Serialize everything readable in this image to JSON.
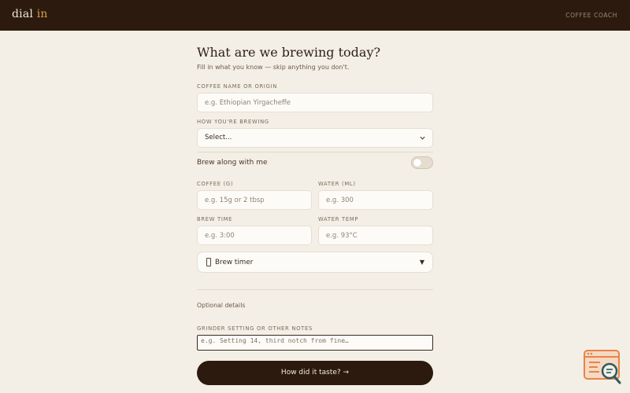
{
  "header": {
    "brand_main": "dial ",
    "brand_accent": "in",
    "nav_link": "COFFEE COACH"
  },
  "form": {
    "title": "What are we brewing today?",
    "subtitle": "Fill in what you know — skip anything you don't.",
    "coffee_name": {
      "label": "COFFEE NAME OR ORIGIN",
      "placeholder": "e.g. Ethiopian Yirgacheffe",
      "value": ""
    },
    "brew_method": {
      "label": "HOW YOU'RE BREWING",
      "selected": "Select..."
    },
    "brew_along": {
      "label": "Brew along with me",
      "enabled": false
    },
    "coffee_amount": {
      "label": "COFFEE (G)",
      "placeholder": "e.g. 15g or 2 tbsp",
      "value": ""
    },
    "water_amount": {
      "label": "WATER (ML)",
      "placeholder": "e.g. 300",
      "value": ""
    },
    "brew_time": {
      "label": "BREW TIME",
      "placeholder": "e.g. 3:00",
      "value": ""
    },
    "water_temp": {
      "label": "WATER TEMP",
      "placeholder": "e.g. 93°C",
      "value": ""
    },
    "timer": {
      "icon": "timer-icon",
      "label": "Brew timer",
      "arrow": "▼"
    },
    "optional_heading": "Optional details",
    "notes": {
      "label": "GRINDER SETTING OR OTHER NOTES",
      "placeholder": "e.g. Setting 14, third notch from fine…",
      "value": ""
    },
    "submit_label": "How did it taste? →"
  },
  "colors": {
    "background": "#f3efe6",
    "header": "#2c1a0e",
    "accent": "#d9a04e",
    "widget": "#e8834a"
  }
}
